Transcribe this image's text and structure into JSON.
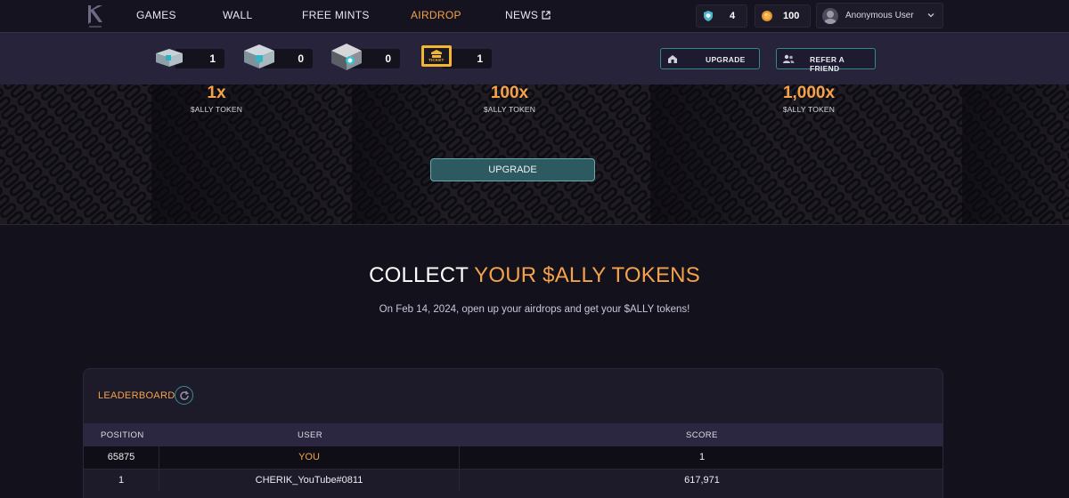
{
  "nav": {
    "items": [
      {
        "label": "GAMES"
      },
      {
        "label": "WALL"
      },
      {
        "label": "FREE MINTS"
      },
      {
        "label": "AIRDROP",
        "active": true
      },
      {
        "label": "NEWS",
        "external": true
      }
    ],
    "gems_count": "4",
    "coins_count": "100",
    "user_name": "Anonymous User"
  },
  "inventory": {
    "chests": [
      {
        "name": "silver-chest",
        "count": "1"
      },
      {
        "name": "large-chest",
        "count": "0"
      },
      {
        "name": "legendary-chest",
        "count": "0"
      },
      {
        "name": "ticket",
        "count": "1",
        "ticket_text": "TICKET"
      }
    ],
    "upgrade_label": "UPGRADE",
    "refer_label": "REFER A FRIEND"
  },
  "hero": {
    "multipliers": [
      {
        "value": "1x",
        "label": "$ALLY TOKEN"
      },
      {
        "value": "100x",
        "label": "$ALLY TOKEN"
      },
      {
        "value": "1,000x",
        "label": "$ALLY TOKEN"
      }
    ],
    "upgrade_label": "UPGRADE"
  },
  "collect": {
    "title_plain": "COLLECT",
    "title_highlight": "YOUR $ALLY TOKENS",
    "subtitle": "On Feb 14, 2024, open up your airdrops and get your $ALLY tokens!"
  },
  "leaderboard": {
    "title": "LEADERBOARD",
    "headers": {
      "position": "POSITION",
      "user": "USER",
      "score": "SCORE"
    },
    "rows": [
      {
        "position": "65875",
        "user": "YOU",
        "score": "1"
      },
      {
        "position": "1",
        "user": "CHERIK_YouTube#0811",
        "score": "617,971"
      }
    ]
  },
  "colors": {
    "accent": "#f5a24b",
    "teal": "#2f8a8a",
    "background": "#13111c"
  }
}
